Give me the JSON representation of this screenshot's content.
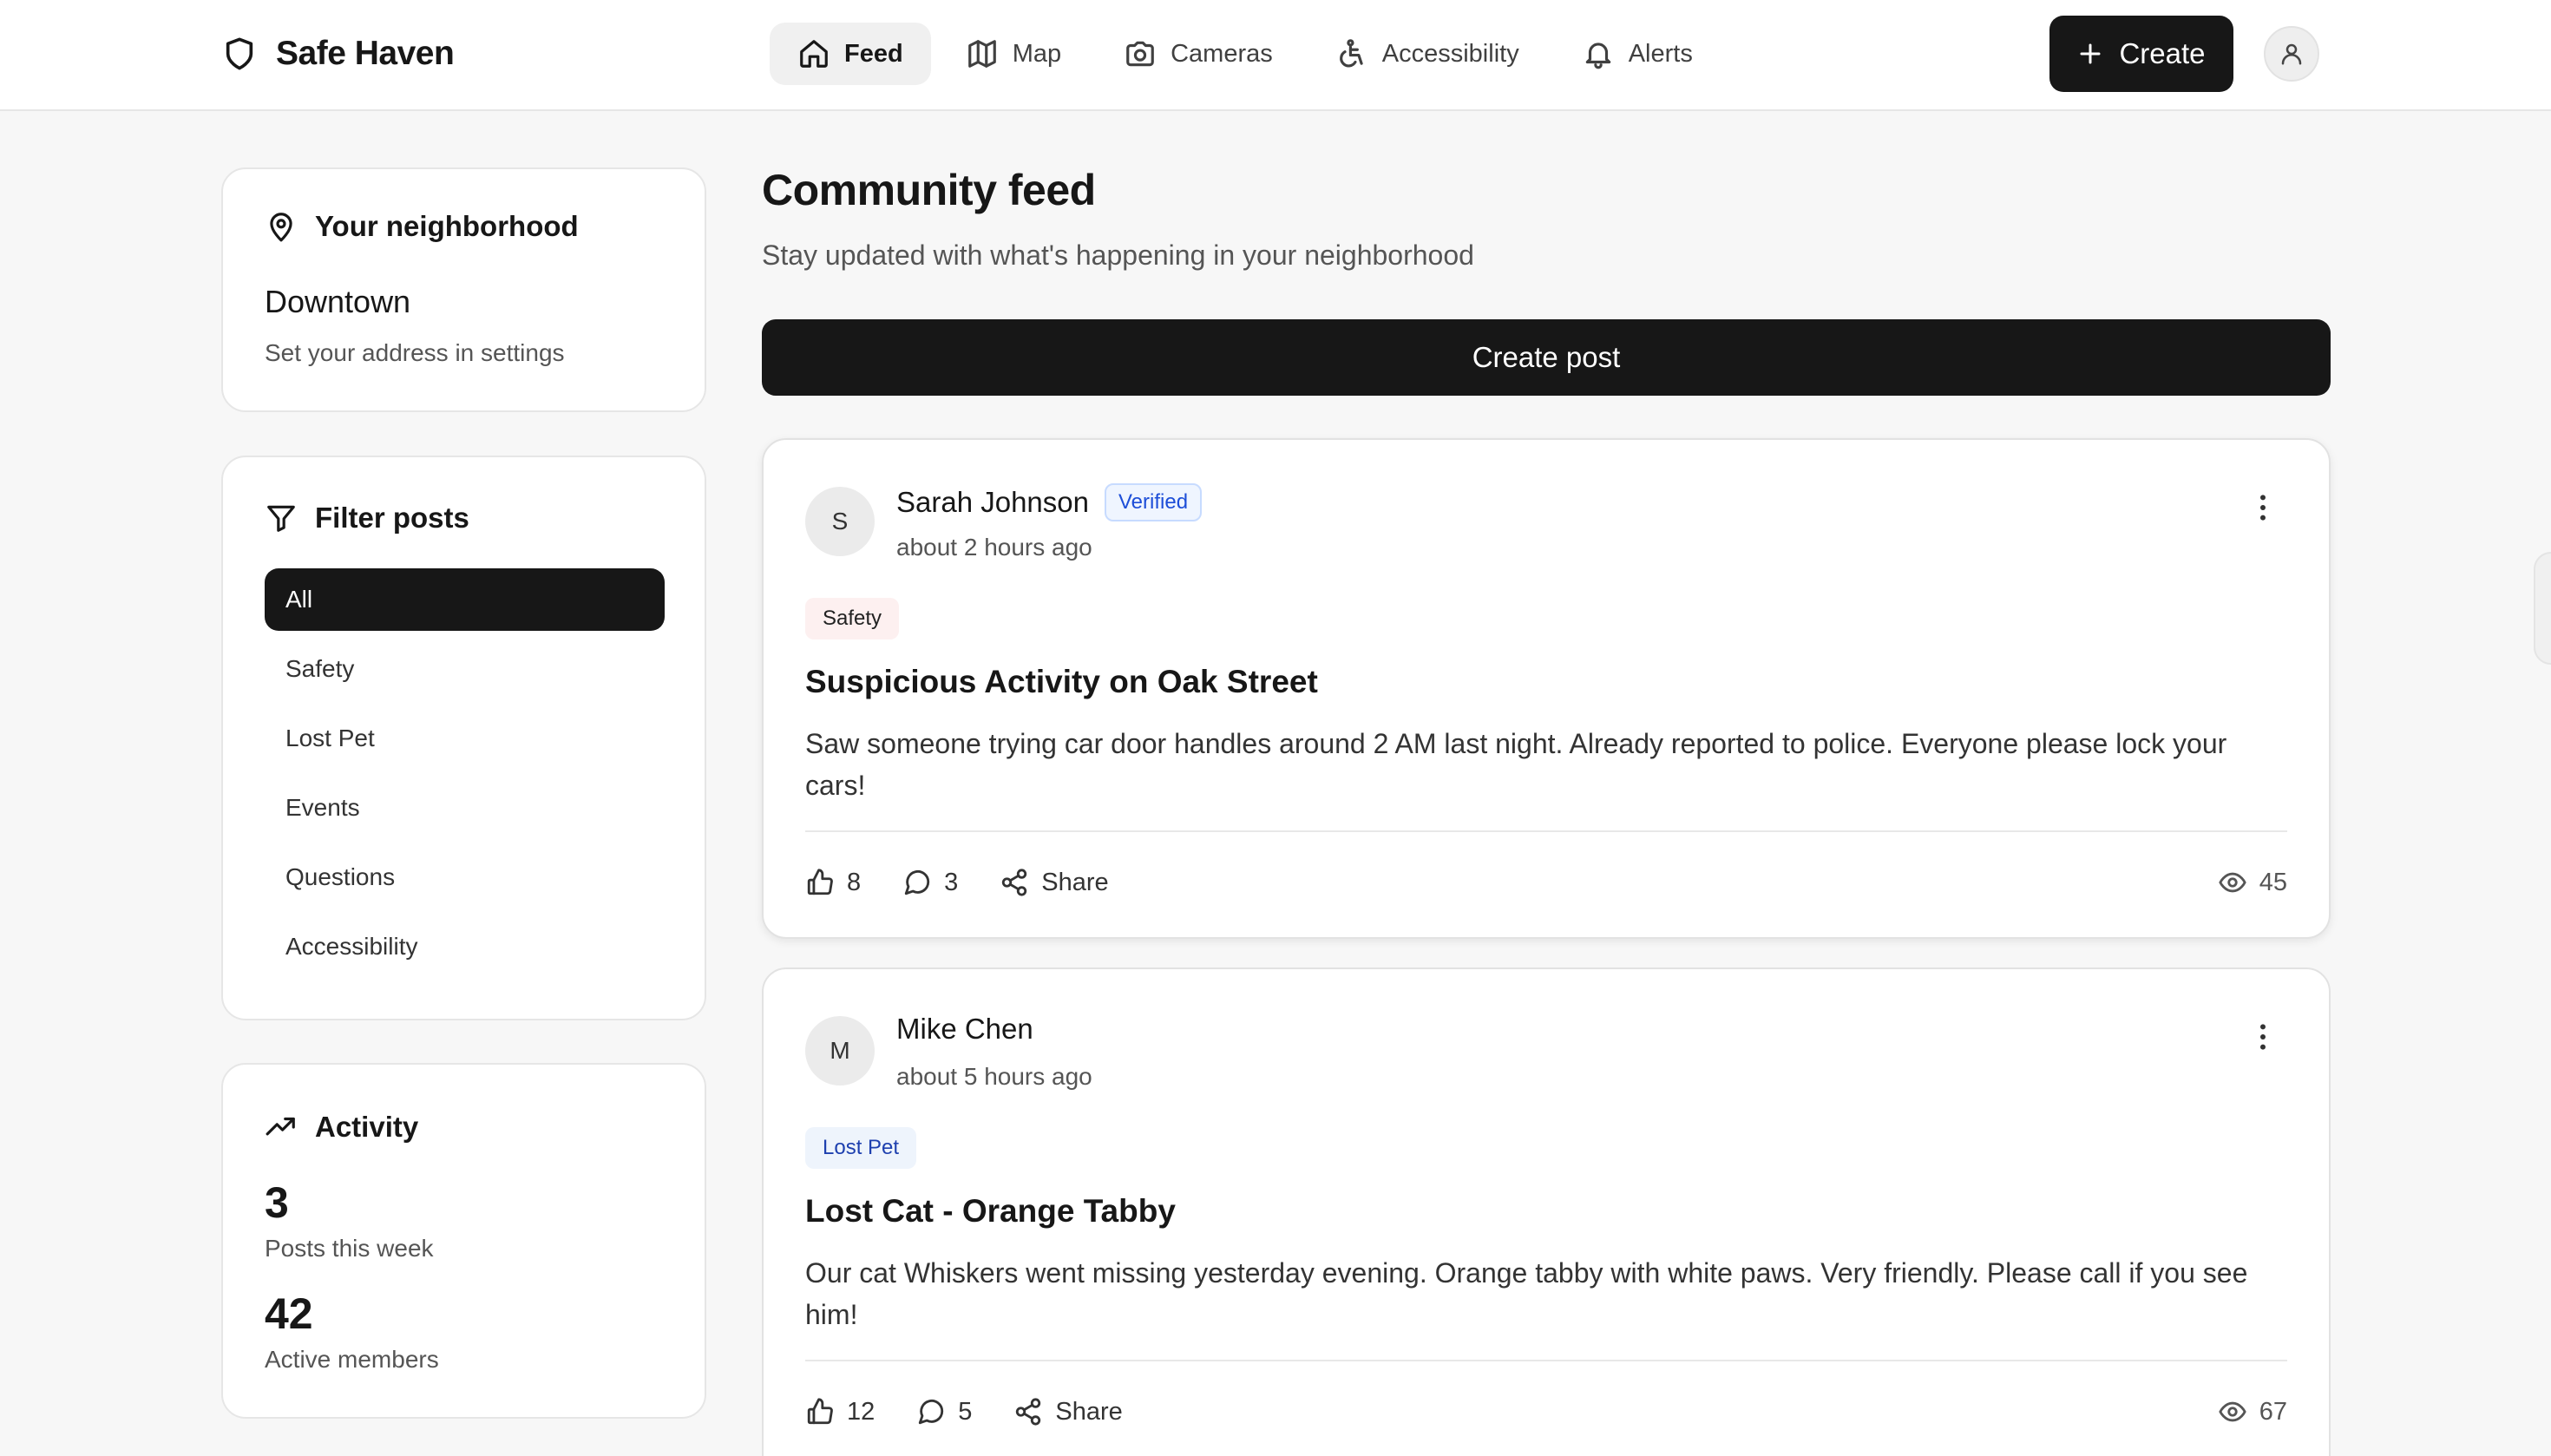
{
  "app": {
    "name": "Safe Haven"
  },
  "nav": {
    "items": [
      {
        "label": "Feed",
        "icon": "home-icon",
        "active": true
      },
      {
        "label": "Map",
        "icon": "map-icon"
      },
      {
        "label": "Cameras",
        "icon": "camera-icon"
      },
      {
        "label": "Accessibility",
        "icon": "accessibility-icon"
      },
      {
        "label": "Alerts",
        "icon": "bell-icon"
      }
    ],
    "create_label": "Create"
  },
  "neighborhood": {
    "title": "Your neighborhood",
    "area": "Downtown",
    "hint": "Set your address in settings"
  },
  "filters": {
    "title": "Filter posts",
    "items": [
      "All",
      "Safety",
      "Lost Pet",
      "Events",
      "Questions",
      "Accessibility"
    ],
    "active": "All"
  },
  "activity": {
    "title": "Activity",
    "stats": [
      {
        "value": "3",
        "label": "Posts this week"
      },
      {
        "value": "42",
        "label": "Active members"
      }
    ]
  },
  "feed": {
    "title": "Community feed",
    "subtitle": "Stay updated with what's happening in your neighborhood",
    "create_post_label": "Create post",
    "posts": [
      {
        "avatar_initial": "S",
        "author": "Sarah Johnson",
        "verified_label": "Verified",
        "time": "about 2 hours ago",
        "tag": "Safety",
        "title": "Suspicious Activity on Oak Street",
        "body": "Saw someone trying car door handles around 2 AM last night. Already reported to police. Everyone please lock your cars!",
        "likes": "8",
        "comments": "3",
        "share_label": "Share",
        "views": "45"
      },
      {
        "avatar_initial": "M",
        "author": "Mike Chen",
        "time": "about 5 hours ago",
        "tag": "Lost Pet",
        "title": "Lost Cat - Orange Tabby",
        "body": "Our cat Whiskers went missing yesterday evening. Orange tabby with white paws. Very friendly. Please call if you see him!",
        "likes": "12",
        "comments": "5",
        "share_label": "Share",
        "views": "67"
      }
    ]
  },
  "colors": {
    "primary": "#171717",
    "background": "#f7f7f7",
    "verified": "#1d4ed8",
    "safety_tag_bg": "#fdf0f0",
    "lost_pet_tag_bg": "#eef4fc"
  }
}
